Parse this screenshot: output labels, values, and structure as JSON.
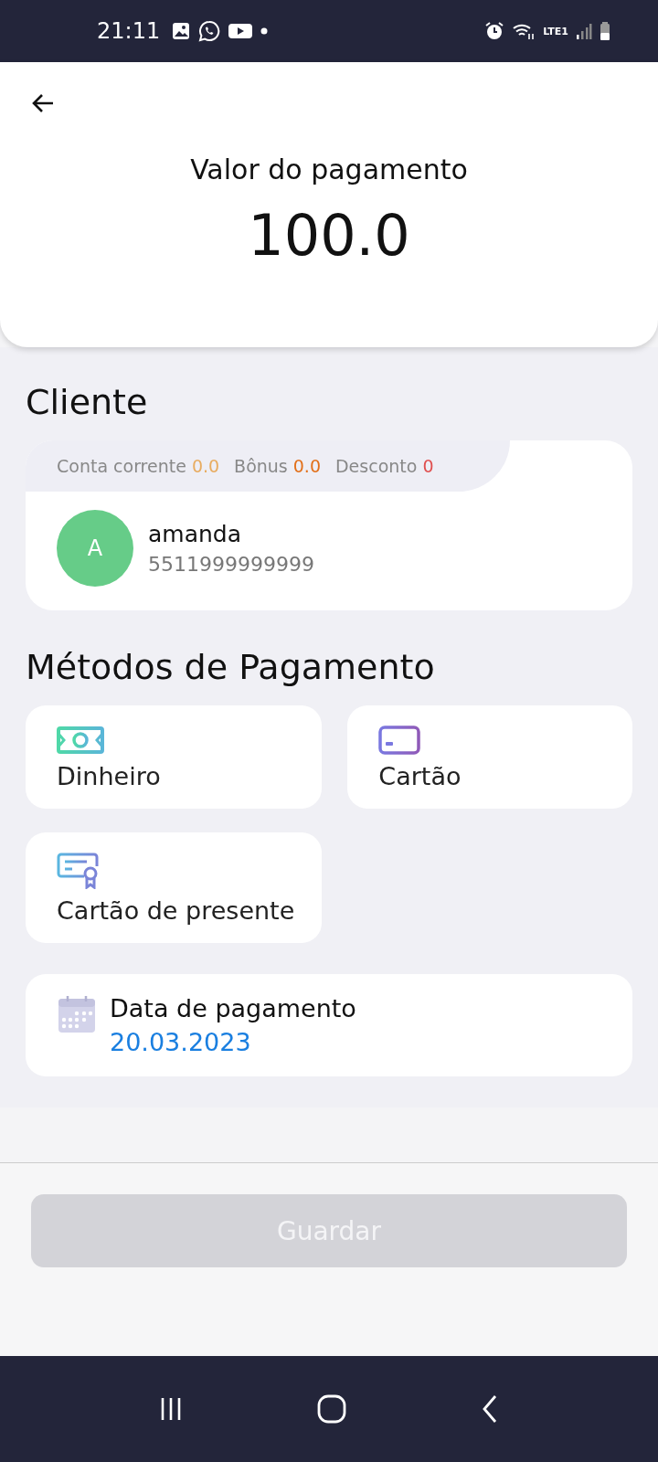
{
  "status_bar": {
    "time": "21:11",
    "network": "LTE1"
  },
  "header": {
    "title": "Valor do pagamento",
    "amount": "100.0"
  },
  "client_section": {
    "title": "Cliente",
    "balances": [
      {
        "label": "Conta corrente",
        "value": "0.0",
        "color": "#e8ac60"
      },
      {
        "label": "Bônus",
        "value": "0.0",
        "color": "#e2701a"
      },
      {
        "label": "Desconto",
        "value": "0",
        "color": "#e05050"
      }
    ],
    "client": {
      "initial": "A",
      "name": "amanda",
      "phone": "5511999999999"
    }
  },
  "payment_methods": {
    "title": "Métodos de Pagamento",
    "items": [
      {
        "kind": "cash",
        "label": "Dinheiro"
      },
      {
        "kind": "card",
        "label": "Cartão"
      },
      {
        "kind": "gift",
        "label": "Cartão de presente"
      }
    ]
  },
  "payment_date": {
    "label": "Data de pagamento",
    "value": "20.03.2023"
  },
  "save_button": {
    "label": "Guardar",
    "disabled": true
  }
}
